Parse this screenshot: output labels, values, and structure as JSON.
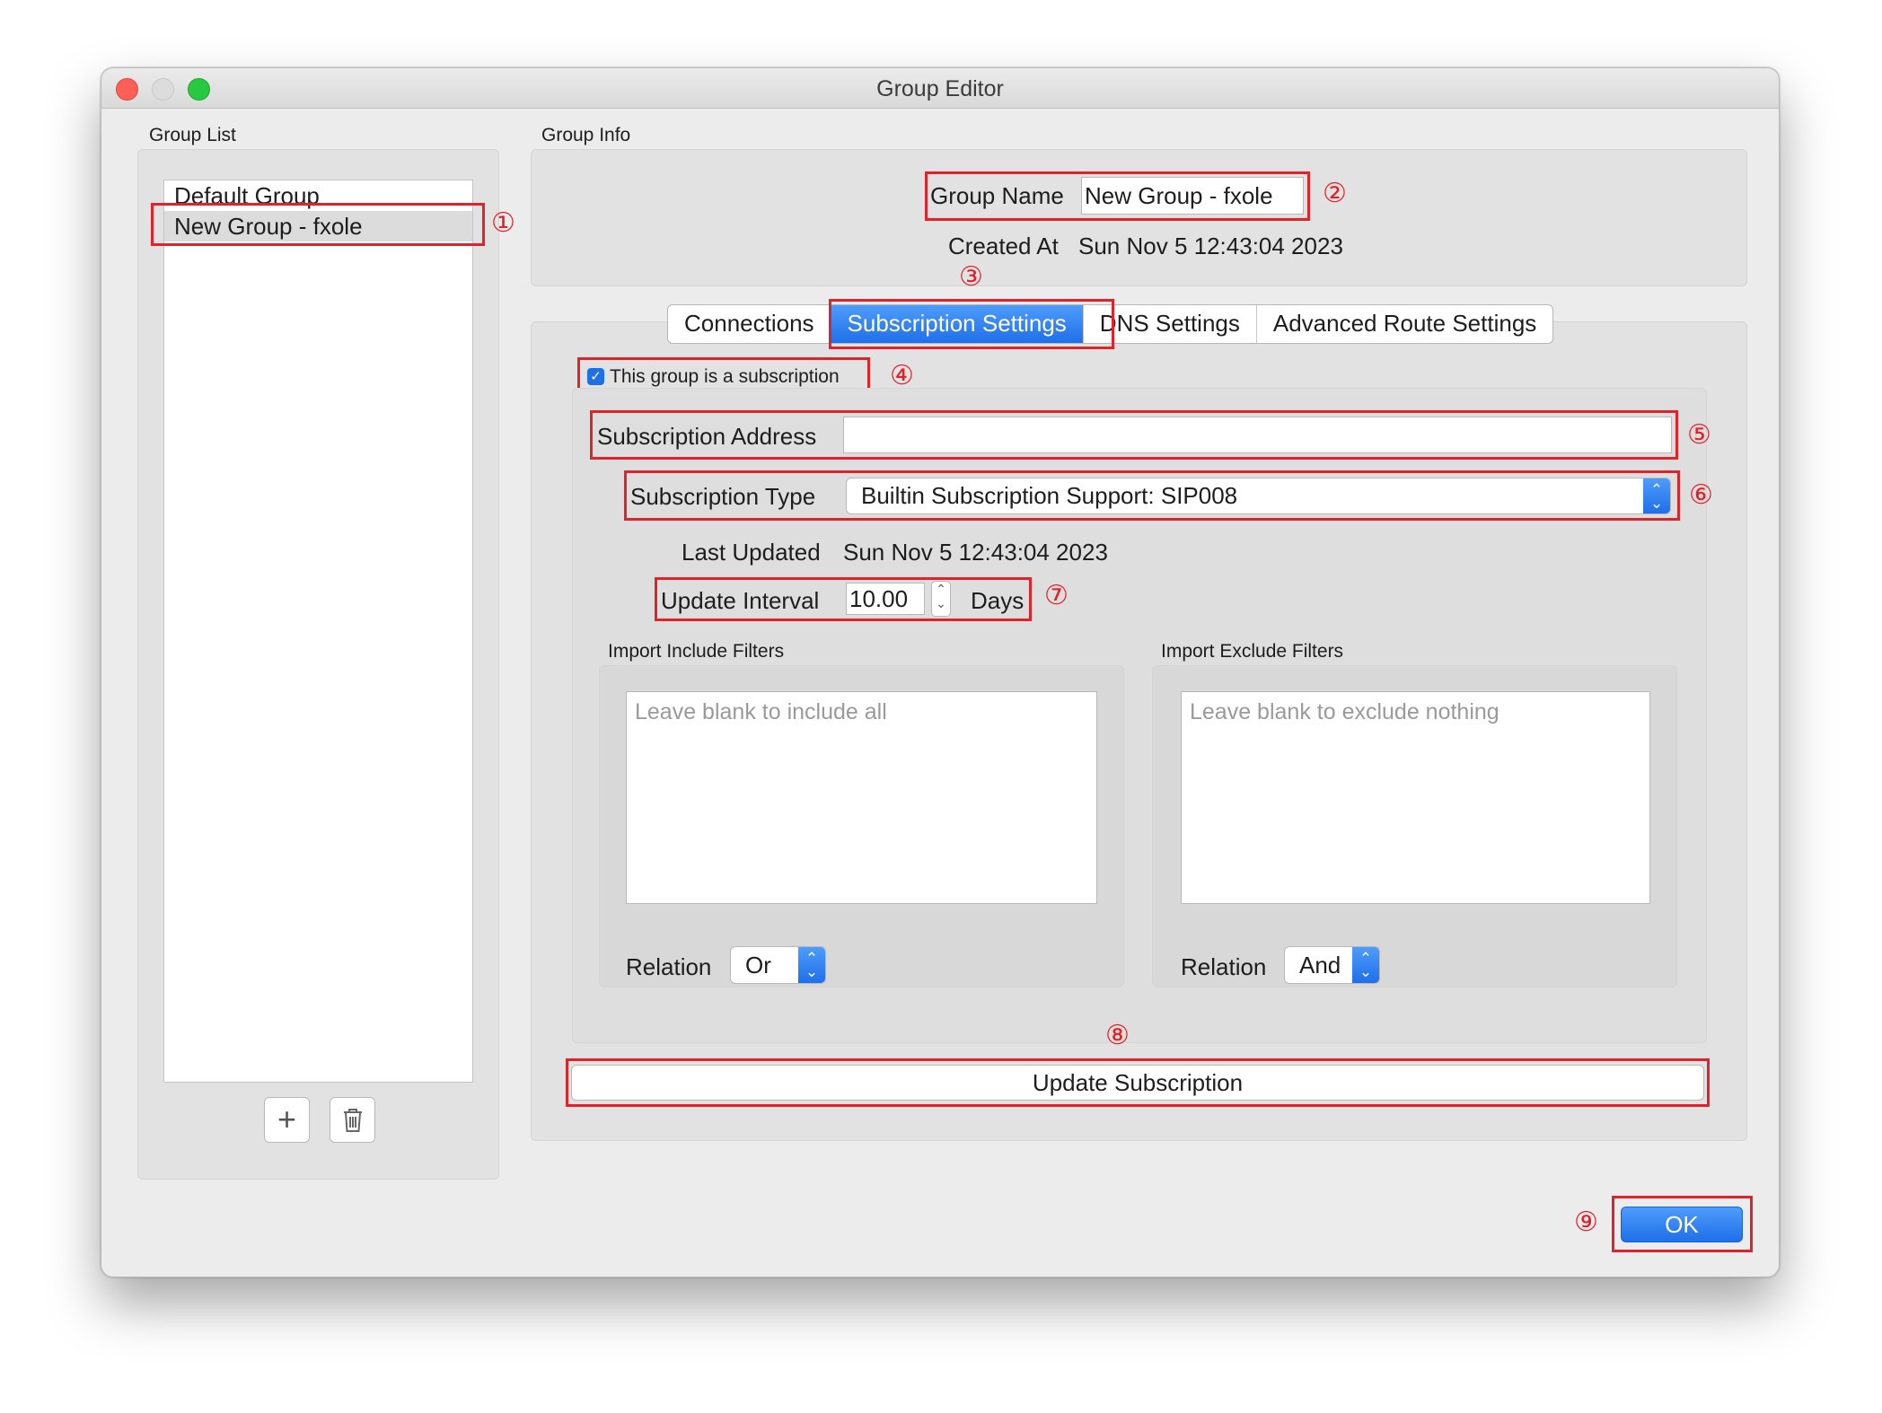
{
  "window": {
    "title": "Group Editor"
  },
  "group_list": {
    "heading": "Group List",
    "items": [
      "Default Group",
      "New Group - fxole"
    ],
    "selected_index": 1,
    "add_icon": "plus-icon",
    "delete_icon": "trash-icon"
  },
  "group_info": {
    "heading": "Group Info",
    "name_label": "Group Name",
    "name_value": "New Group - fxole",
    "created_label": "Created At",
    "created_value": "Sun Nov 5 12:43:04 2023"
  },
  "tabs": [
    "Connections",
    "Subscription Settings",
    "DNS Settings",
    "Advanced Route Settings"
  ],
  "active_tab": "Subscription Settings",
  "subscription": {
    "checkbox_label": "This group is a subscription",
    "checked": true,
    "address_label": "Subscription Address",
    "address_value": "",
    "type_label": "Subscription Type",
    "type_value": "Builtin Subscription Support: SIP008",
    "last_updated_label": "Last Updated",
    "last_updated_value": "Sun Nov 5 12:43:04 2023",
    "interval_label": "Update Interval",
    "interval_value": "10.00",
    "interval_unit": "Days",
    "include": {
      "heading": "Import Include Filters",
      "placeholder": "Leave blank to include all",
      "relation_label": "Relation",
      "relation_value": "Or"
    },
    "exclude": {
      "heading": "Import Exclude Filters",
      "placeholder": "Leave blank to exclude nothing",
      "relation_label": "Relation",
      "relation_value": "And"
    },
    "update_button": "Update Subscription"
  },
  "ok_button": "OK",
  "annotations": [
    "①",
    "②",
    "③",
    "④",
    "⑤",
    "⑥",
    "⑦",
    "⑧",
    "⑨"
  ],
  "colors": {
    "accent": "#1f6fe9",
    "annotation_red": "#e0222a"
  }
}
